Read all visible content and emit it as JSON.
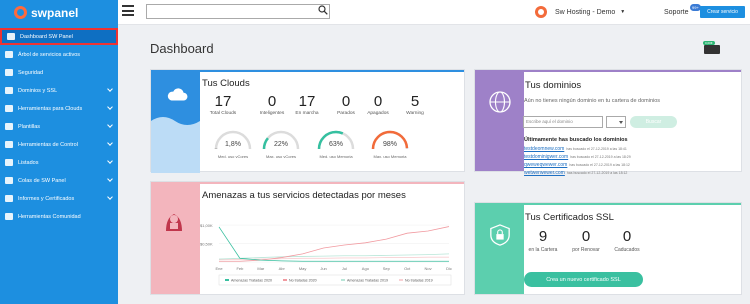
{
  "header": {
    "logo_text": "swpanel",
    "search_placeholder": "",
    "company": "Sw Hosting - Demo",
    "support": "Soporte",
    "support_badge": "99+",
    "create_service": "Crear servicio"
  },
  "sidebar": {
    "items": [
      {
        "label": "Dashboard SW Panel",
        "icon": "dashboard-icon",
        "active": true,
        "has_submenu": false
      },
      {
        "label": "Árbol de servicios activos",
        "icon": "tree-icon",
        "has_submenu": false
      },
      {
        "label": "Seguridad",
        "icon": "shield-icon",
        "has_submenu": false
      },
      {
        "label": "Dominios y SSL",
        "icon": "globe-icon",
        "has_submenu": true
      },
      {
        "label": "Herramientas para Clouds",
        "icon": "cloud-icon",
        "has_submenu": true
      },
      {
        "label": "Plantillas",
        "icon": "template-icon",
        "has_submenu": true
      },
      {
        "label": "Herramientas de Control",
        "icon": "check-icon",
        "has_submenu": true
      },
      {
        "label": "Listados",
        "icon": "list-icon",
        "has_submenu": true
      },
      {
        "label": "Colas de SW Panel",
        "icon": "queue-icon",
        "has_submenu": true
      },
      {
        "label": "Informes y Certificados",
        "icon": "report-icon",
        "has_submenu": true
      },
      {
        "label": "Herramientas Comunidad",
        "icon": "community-icon",
        "has_submenu": false
      }
    ]
  },
  "page": {
    "title": "Dashboard",
    "wallet_badge": "0,00€"
  },
  "clouds": {
    "title": "Tus Clouds",
    "stats": [
      {
        "value": "17",
        "label": "Total Clouds"
      },
      {
        "value": "0",
        "label": "Inteligentes"
      },
      {
        "value": "17",
        "label": "En marcha"
      },
      {
        "value": "0",
        "label": "Parados"
      },
      {
        "value": "0",
        "label": "Apagados"
      },
      {
        "value": "5",
        "label": "Warning"
      }
    ],
    "gauges": [
      {
        "value": "1,8%",
        "label": "Med. uso vCores",
        "fraction": 0.018,
        "color": "#bbbbbb"
      },
      {
        "value": "22%",
        "label": "Max. uso vCores",
        "fraction": 0.22,
        "color": "#35c0a0"
      },
      {
        "value": "63%",
        "label": "Med. uso Memoria",
        "fraction": 0.63,
        "color": "#35c0a0"
      },
      {
        "value": "98%",
        "label": "Max. uso Memoria",
        "fraction": 0.98,
        "color": "#f26b3a"
      }
    ]
  },
  "domains": {
    "title": "Tus dominios",
    "no_domains_text": "Aún no tienes ningún dominio en tu cartera de dominios",
    "input_placeholder": "Escribe aquí el dominio",
    "button": "Buscar",
    "last_title": "Últimamente has buscado los dominios",
    "items": [
      {
        "name": "testdeomnew.com",
        "meta": "has buscado el 27-12-2019 a las 18:41"
      },
      {
        "name": "testdominigwer.com",
        "meta": "has buscado el 27-12-2019 a las 18:29"
      },
      {
        "name": "qweweqwewer.com",
        "meta": "has buscado el 27-12-2019 a las 18:12"
      },
      {
        "name": "wetwerwewer.com",
        "meta": "has buscado el 27-12-2019 a las 18:12"
      }
    ]
  },
  "threats": {
    "title": "Amenazas a tus servicios detectadas por meses"
  },
  "ssl": {
    "title": "Tus Certificados SSL",
    "stats": [
      {
        "value": "9",
        "label": "en la Cartera"
      },
      {
        "value": "0",
        "label": "por Renovar"
      },
      {
        "value": "0",
        "label": "Caducados"
      }
    ],
    "button": "Crea un nuevo certificado SSL"
  },
  "chart_data": {
    "type": "line",
    "categories": [
      "Ene",
      "Feb",
      "Mar",
      "Abr",
      "May",
      "Jun",
      "Jul",
      "Ago",
      "Sep",
      "Oct",
      "Nov",
      "Dic"
    ],
    "ytick_labels": [
      "$1,00K",
      "$0,50K"
    ],
    "ylim": [
      0,
      1.3
    ],
    "series": [
      {
        "name": "Amenazas Tratadas 2020",
        "color": "#3ac0a0",
        "values": [
          0.95,
          0.1,
          0.05,
          0.03,
          0.02,
          0.02,
          0.02,
          0.02,
          0.02,
          0.02,
          0.02,
          0.02
        ]
      },
      {
        "name": "No tratadas 2020",
        "color": "#f19aa0",
        "values": [
          0.02,
          0.02,
          0.05,
          0.12,
          0.22,
          0.38,
          0.46,
          0.52,
          0.62,
          0.78,
          0.84,
          0.96
        ]
      },
      {
        "name": "Amenazas Tratadas 2019",
        "color": "#b9e6d8",
        "values": [
          0.08,
          0.1,
          0.12,
          0.14,
          0.15,
          0.16,
          0.17,
          0.17,
          0.18,
          0.19,
          0.2,
          0.22
        ]
      },
      {
        "name": "No tratadas 2019",
        "color": "#f8d0d3",
        "values": [
          0.06,
          0.07,
          0.08,
          0.09,
          0.1,
          0.1,
          0.11,
          0.11,
          0.12,
          0.12,
          0.13,
          0.13
        ]
      }
    ]
  }
}
